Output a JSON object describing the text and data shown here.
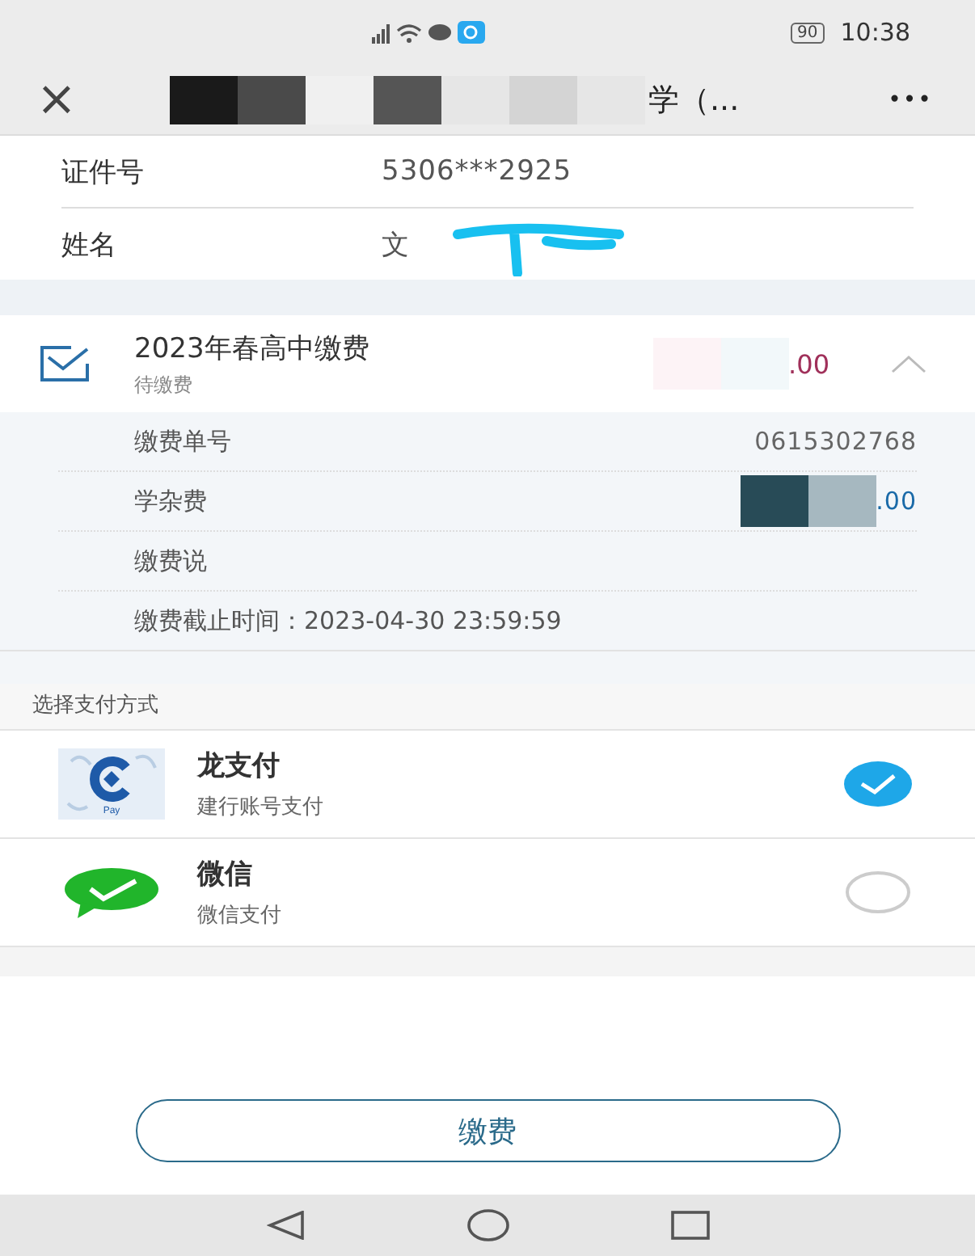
{
  "status_bar": {
    "battery": "90",
    "time": "10:38"
  },
  "nav": {
    "close": "×",
    "title_visible": "学（...",
    "more": "•••"
  },
  "info_rows": [
    {
      "label": "证件号",
      "value": "5306***2925",
      "redacted": false
    },
    {
      "label": "姓名",
      "value": "文",
      "redacted": true
    }
  ],
  "bill": {
    "title": "2023年春高中缴费",
    "status": "待缴费",
    "amount_visible": ".00",
    "expanded": true,
    "details": [
      {
        "label": "缴费单号",
        "value": "0615302768",
        "kind": "plain"
      },
      {
        "label": "学杂费",
        "value": ".00",
        "kind": "amount"
      },
      {
        "label": "缴费说",
        "kind": "plain"
      },
      {
        "label": "缴费截止时间：2023-04-30 23:59:59",
        "kind": "plain"
      }
    ]
  },
  "payment_section": {
    "label": "选择支付方式"
  },
  "payment_methods": [
    {
      "name": "龙支付",
      "desc": "建行账号支付",
      "kind": "bank",
      "logo_text": "Pay",
      "selected": true
    },
    {
      "name": "微信",
      "desc": "微信支付",
      "kind": "wechat",
      "selected": false
    }
  ],
  "pay_button": "缴费"
}
